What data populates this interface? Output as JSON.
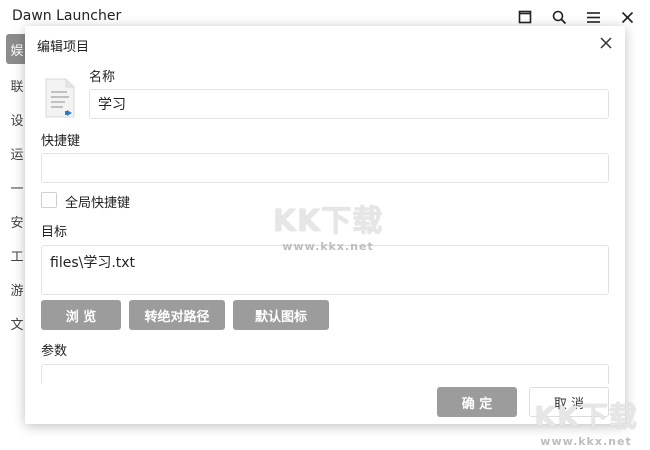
{
  "app": {
    "title": "Dawn Launcher",
    "sidebar": [
      "娱",
      "联",
      "设",
      "运",
      "一",
      "安",
      "工",
      "游",
      "文"
    ]
  },
  "dialog": {
    "title": "编辑项目",
    "name_label": "名称",
    "name_value": "学习",
    "shortcut_label": "快捷键",
    "shortcut_value": "",
    "global_shortcut_label": "全局快捷键",
    "target_label": "目标",
    "target_value": "files\\学习.txt",
    "browse_button": "浏 览",
    "to_absolute_button": "转绝对路径",
    "default_icon_button": "默认图标",
    "params_label": "参数",
    "params_value": "",
    "ok_button": "确 定",
    "cancel_button": "取 消"
  },
  "watermark": {
    "logo": "KK下载",
    "url": "www.kkx.net"
  },
  "colors": {
    "button_gray": "#9c9c9c",
    "active_side": "#8c8c8c"
  }
}
